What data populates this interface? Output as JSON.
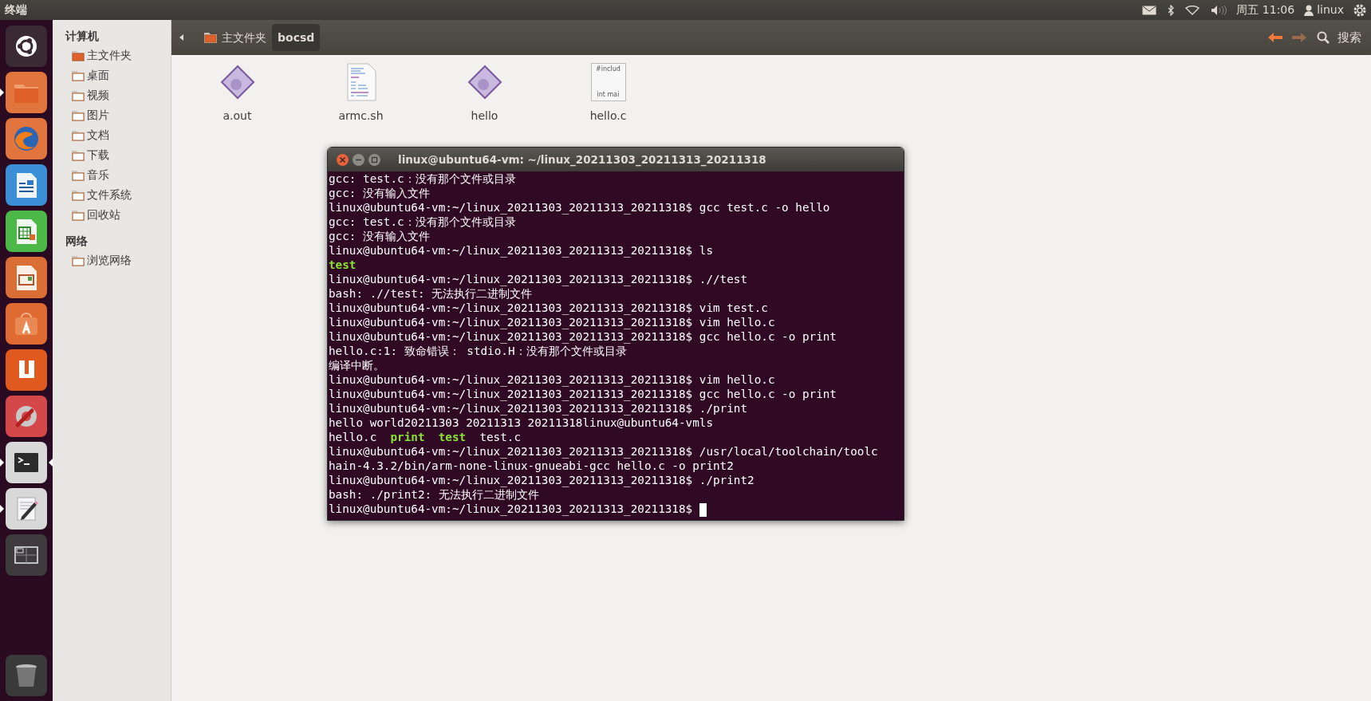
{
  "top_panel": {
    "title": "终端",
    "clock": "周五 11:06",
    "user": "linux"
  },
  "launcher": {
    "items": [
      {
        "kind": "dash",
        "running": false,
        "focused": false
      },
      {
        "kind": "files",
        "running": true,
        "focused": false
      },
      {
        "kind": "browser",
        "running": false,
        "focused": false
      },
      {
        "kind": "writer",
        "running": false,
        "focused": false
      },
      {
        "kind": "calc",
        "running": false,
        "focused": false
      },
      {
        "kind": "impress",
        "running": false,
        "focused": false
      },
      {
        "kind": "software",
        "running": false,
        "focused": false
      },
      {
        "kind": "ubuntu_one",
        "running": false,
        "focused": false
      },
      {
        "kind": "settings",
        "running": false,
        "focused": false
      },
      {
        "kind": "terminal",
        "running": true,
        "focused": true
      },
      {
        "kind": "editor",
        "running": true,
        "focused": false
      },
      {
        "kind": "workspaces",
        "running": false,
        "focused": false
      }
    ],
    "bottom": {
      "kind": "trash",
      "running": false,
      "focused": false
    }
  },
  "sidebar": {
    "sections": [
      {
        "heading": "计算机",
        "items": [
          {
            "label": "主文件夹"
          },
          {
            "label": "桌面"
          },
          {
            "label": "视频"
          },
          {
            "label": "图片"
          },
          {
            "label": "文档"
          },
          {
            "label": "下载"
          },
          {
            "label": "音乐"
          },
          {
            "label": "文件系统"
          },
          {
            "label": "回收站"
          }
        ]
      },
      {
        "heading": "网络",
        "items": [
          {
            "label": "浏览网络"
          }
        ]
      }
    ]
  },
  "toolbar": {
    "breadcrumbs": [
      {
        "label": "主文件夹",
        "kind": "home",
        "selected": false
      },
      {
        "label": "bocsd",
        "kind": "folder",
        "selected": true
      }
    ],
    "back_enabled": true,
    "forward_enabled": false,
    "search_label": "搜索"
  },
  "files": [
    {
      "name": "a.out",
      "kind": "executable"
    },
    {
      "name": "armc.sh",
      "kind": "script"
    },
    {
      "name": "hello",
      "kind": "executable"
    },
    {
      "name": "hello.c",
      "kind": "source",
      "preview": [
        "#includ",
        "int mai"
      ]
    }
  ],
  "terminal": {
    "title": "linux@ubuntu64-vm: ~/linux_20211303_20211313_20211318",
    "lines": [
      {
        "text": "gcc: test.c：没有那个文件或目录",
        "cursor": false
      },
      {
        "text": "gcc: 没有输入文件",
        "cursor": false
      },
      {
        "text": "linux@ubuntu64-vm:~/linux_20211303_20211313_20211318$ gcc test.c -o hello",
        "cursor": false
      },
      {
        "text": "gcc: test.c：没有那个文件或目录",
        "cursor": false
      },
      {
        "text": "gcc: 没有输入文件",
        "cursor": false
      },
      {
        "text": "linux@ubuntu64-vm:~/linux_20211303_20211313_20211318$ ls",
        "cursor": false
      },
      {
        "spans": [
          {
            "text": "test",
            "kind": "exec"
          }
        ],
        "cursor": false
      },
      {
        "text": "linux@ubuntu64-vm:~/linux_20211303_20211313_20211318$ .//test",
        "cursor": false
      },
      {
        "text": "bash: .//test: 无法执行二进制文件",
        "cursor": false
      },
      {
        "text": "linux@ubuntu64-vm:~/linux_20211303_20211313_20211318$ vim test.c",
        "cursor": false
      },
      {
        "text": "linux@ubuntu64-vm:~/linux_20211303_20211313_20211318$ vim hello.c",
        "cursor": false
      },
      {
        "text": "linux@ubuntu64-vm:~/linux_20211303_20211313_20211318$ gcc hello.c -o print",
        "cursor": false
      },
      {
        "text": "hello.c:1: 致命错误： stdio.H：没有那个文件或目录",
        "cursor": false
      },
      {
        "text": "编译中断。",
        "cursor": false
      },
      {
        "text": "linux@ubuntu64-vm:~/linux_20211303_20211313_20211318$ vim hello.c",
        "cursor": false
      },
      {
        "text": "linux@ubuntu64-vm:~/linux_20211303_20211313_20211318$ gcc hello.c -o print",
        "cursor": false
      },
      {
        "text": "linux@ubuntu64-vm:~/linux_20211303_20211313_20211318$ ./print",
        "cursor": false
      },
      {
        "text": "hello world20211303 20211313 20211318linux@ubuntu64-vmls",
        "cursor": false
      },
      {
        "spans": [
          {
            "text": "hello.c  ",
            "kind": "plain"
          },
          {
            "text": "print  ",
            "kind": "exec"
          },
          {
            "text": "test",
            "kind": "exec"
          },
          {
            "text": "  test.c",
            "kind": "plain"
          }
        ],
        "cursor": false
      },
      {
        "text": "linux@ubuntu64-vm:~/linux_20211303_20211313_20211318$ /usr/local/toolchain/toolc",
        "cursor": false
      },
      {
        "text": "hain-4.3.2/bin/arm-none-linux-gnueabi-gcc hello.c -o print2",
        "cursor": false
      },
      {
        "text": "linux@ubuntu64-vm:~/linux_20211303_20211313_20211318$ ./print2",
        "cursor": false
      },
      {
        "text": "bash: ./print2: 无法执行二进制文件",
        "cursor": false
      },
      {
        "text": "linux@ubuntu64-vm:~/linux_20211303_20211313_20211318$ ",
        "cursor": true
      }
    ]
  }
}
